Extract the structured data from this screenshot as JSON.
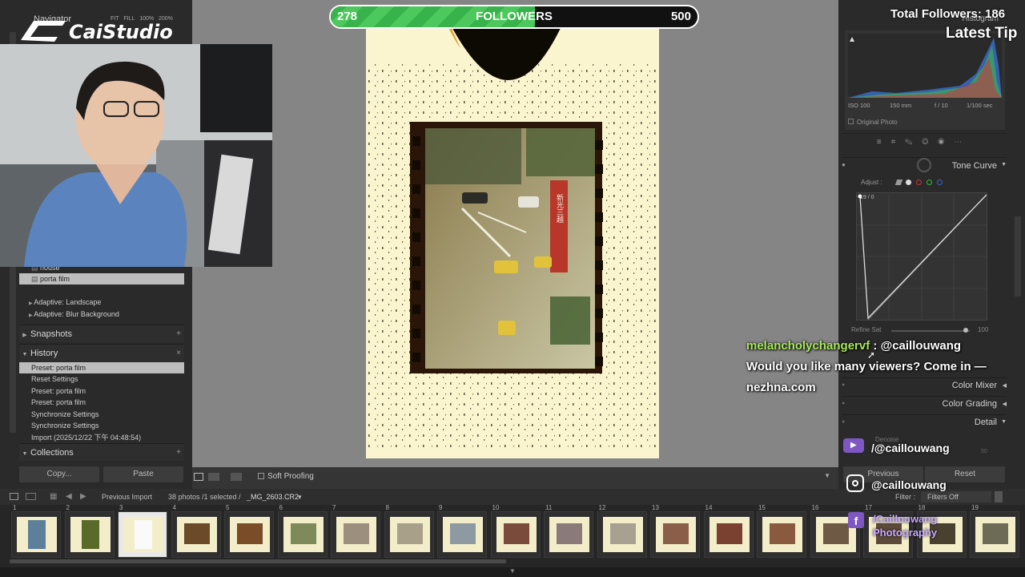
{
  "stream": {
    "logo_text": "CaiStudio",
    "followers_bar": {
      "current": "278",
      "label": "FOLLOWERS",
      "goal": "500",
      "progress_fraction": 0.556
    },
    "total_followers": "Total Followers: 186",
    "latest_tip": "Latest Tip",
    "chat": {
      "username": "melancholychangervf",
      "separator": ":",
      "mention": "@caillouwang",
      "message": "Would you like many viewers? Come in — nezhna.com"
    },
    "socials": {
      "youtube": "/@caillouwang",
      "instagram": "@caillouwang",
      "facebook_line1": "/Caillouwang",
      "facebook_line2": "Photography"
    }
  },
  "left_panel": {
    "navigator": {
      "title": "Navigator",
      "zoom_options": [
        "FIT",
        "FILL",
        "100%",
        "200%"
      ]
    },
    "presets": {
      "item_house": "house",
      "item_porta_film": "porta film",
      "adaptive_landscape": "Adaptive: Landscape",
      "adaptive_blur": "Adaptive: Blur Background"
    },
    "snapshots": {
      "title": "Snapshots",
      "action": "+"
    },
    "history": {
      "title": "History",
      "action": "×",
      "items": [
        "Preset: porta film",
        "Reset Settings",
        "Preset: porta film",
        "Preset: porta film",
        "Synchronize Settings",
        "Synchronize Settings",
        "Import (2025/12/22 下午 04:48:54)"
      ]
    },
    "collections": {
      "title": "Collections",
      "action": "+"
    },
    "copy_button": "Copy...",
    "paste_button": "Paste"
  },
  "toolbar": {
    "soft_proofing": "Soft Proofing"
  },
  "right_panel": {
    "histogram": {
      "title": "Histogram",
      "iso": "ISO 100",
      "focal": "150 mm",
      "aperture": "f / 10",
      "shutter": "1/100 sec",
      "original_photo": "Original Photo"
    },
    "tone_curve": {
      "title": "Tone Curve",
      "adjust_label": "Adjust :",
      "point_readout": "19 / 0",
      "refine_label": "Refine Sat",
      "refine_value": "100"
    },
    "sections": {
      "color_mixer": "Color Mixer",
      "color_grading": "Color Grading",
      "detail": "Detail",
      "denoise": "Denoise",
      "denoise_value": "50"
    },
    "previous_button": "Previous",
    "reset_button": "Reset",
    "filter_label": "Filter :",
    "filter_value": "Filters Off"
  },
  "filmstrip": {
    "source": "Previous Import",
    "count_text": "38 photos /1 selected /",
    "filename": "_MG_2603.CR2",
    "dropdown": "▾",
    "thumb_numbers": [
      "1",
      "2",
      "3",
      "4",
      "5",
      "6",
      "7",
      "8",
      "9",
      "10",
      "11",
      "12",
      "13",
      "14",
      "15",
      "16",
      "17",
      "18",
      "19"
    ],
    "selected_index": 2
  },
  "photo_sign": "新光三越",
  "colors": {
    "accent_green": "#38b24a",
    "panel_bg": "#2a2a2a",
    "selection": "#bdbdbd",
    "chat_username": "#a7e85a"
  }
}
